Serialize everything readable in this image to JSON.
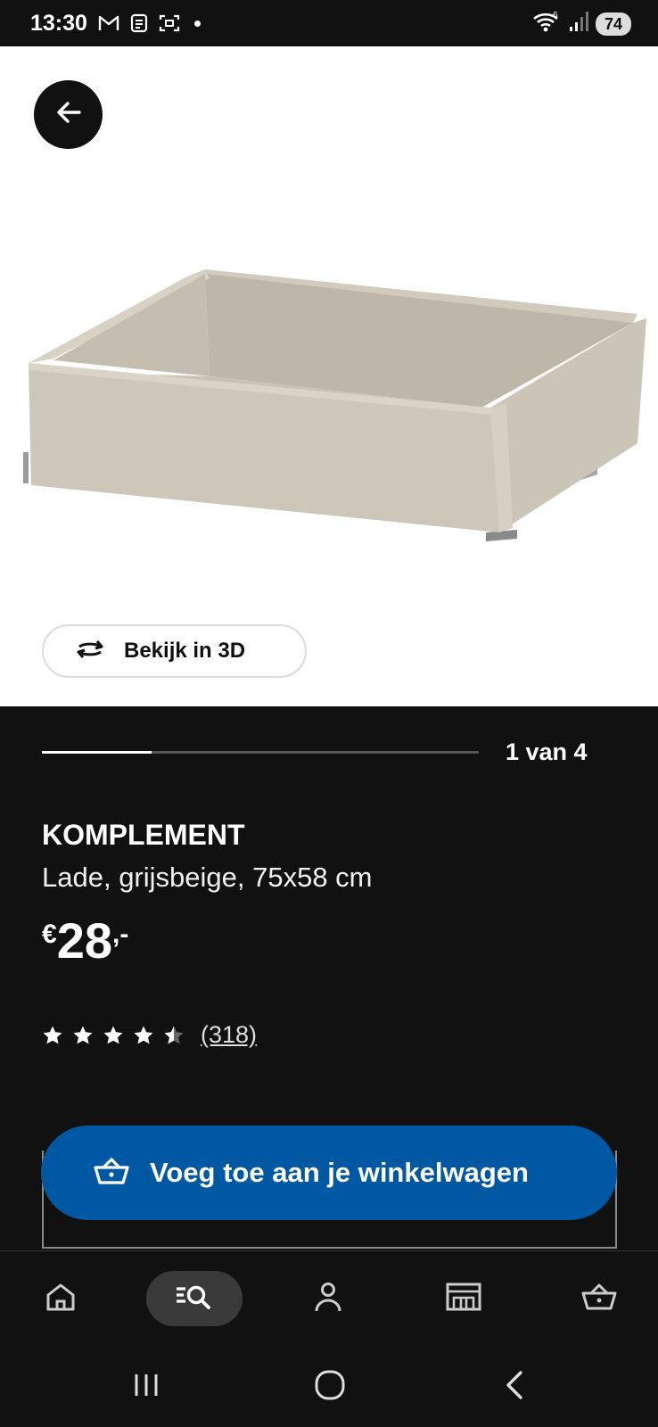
{
  "status_bar": {
    "time": "13:30",
    "battery": "74",
    "icons": [
      "gmail-icon",
      "notes-icon",
      "screenshot-icon",
      "wifi-icon",
      "signal-icon",
      "battery-icon"
    ]
  },
  "image_area": {
    "back_icon": "arrow-left-icon",
    "view3d_label": "Bekijk in 3D",
    "view3d_icon": "rotate-3d-icon"
  },
  "pager": {
    "label": "1 van 4",
    "current": 1,
    "total": 4
  },
  "product": {
    "name": "KOMPLEMENT",
    "description": "Lade, grijsbeige, 75x58 cm",
    "price_currency": "€",
    "price_amount": "28",
    "price_suffix": ",-",
    "rating": 4.5,
    "review_count": "(318)"
  },
  "cta": {
    "label": "Voeg toe aan je winkelwagen",
    "icon": "cart-icon",
    "color": "#0058a3"
  },
  "bottom_nav": {
    "items": [
      {
        "name": "home",
        "icon": "home-icon"
      },
      {
        "name": "search",
        "icon": "search-list-icon",
        "active": true
      },
      {
        "name": "profile",
        "icon": "person-icon"
      },
      {
        "name": "store",
        "icon": "store-icon"
      },
      {
        "name": "cart",
        "icon": "cart-icon"
      }
    ]
  },
  "system_nav": {
    "items": [
      "recents-icon",
      "home-icon",
      "back-icon"
    ]
  }
}
